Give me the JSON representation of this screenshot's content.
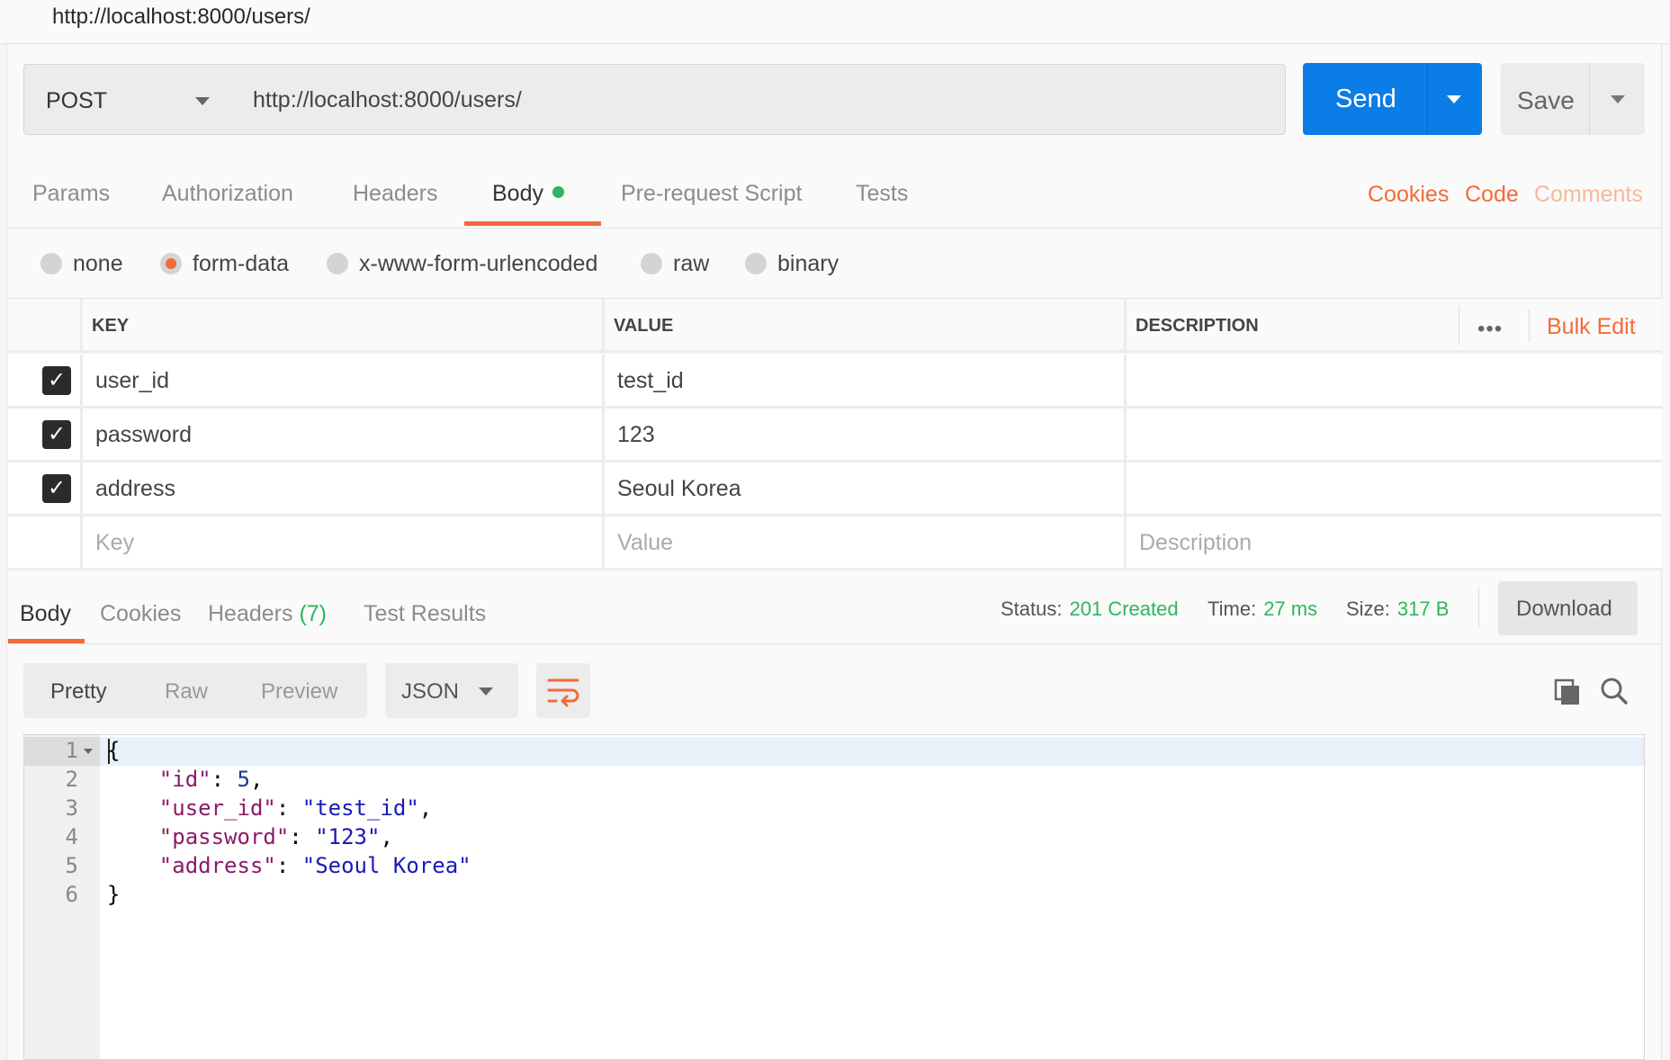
{
  "window": {
    "title": "http://localhost:8000/users/"
  },
  "request": {
    "method": "POST",
    "url": "http://localhost:8000/users/",
    "send_label": "Send",
    "save_label": "Save"
  },
  "request_tabs": {
    "items": [
      {
        "label": "Params"
      },
      {
        "label": "Authorization"
      },
      {
        "label": "Headers"
      },
      {
        "label": "Body",
        "active": true
      },
      {
        "label": "Pre-request Script"
      },
      {
        "label": "Tests"
      }
    ],
    "right_links": [
      "Cookies",
      "Code",
      "Comments"
    ]
  },
  "body_types": {
    "options": [
      "none",
      "form-data",
      "x-www-form-urlencoded",
      "raw",
      "binary"
    ],
    "selected": "form-data"
  },
  "form_table": {
    "headers": {
      "key": "KEY",
      "value": "VALUE",
      "description": "DESCRIPTION"
    },
    "more": "•••",
    "bulk_edit": "Bulk Edit",
    "rows": [
      {
        "checked": true,
        "key": "user_id",
        "value": "test_id",
        "description": ""
      },
      {
        "checked": true,
        "key": "password",
        "value": "123",
        "description": ""
      },
      {
        "checked": true,
        "key": "address",
        "value": "Seoul Korea",
        "description": ""
      }
    ],
    "placeholders": {
      "key": "Key",
      "value": "Value",
      "description": "Description"
    }
  },
  "response": {
    "tabs": {
      "body": "Body",
      "cookies": "Cookies",
      "headers": "Headers",
      "headers_count": "(7)",
      "test_results": "Test Results"
    },
    "status_label": "Status:",
    "status_value": "201 Created",
    "time_label": "Time:",
    "time_value": "27 ms",
    "size_label": "Size:",
    "size_value": "317 B",
    "download_label": "Download",
    "view_modes": [
      "Pretty",
      "Raw",
      "Preview"
    ],
    "format": "JSON",
    "line_numbers": [
      "1",
      "2",
      "3",
      "4",
      "5",
      "6"
    ],
    "json": {
      "open": "{",
      "close": "}",
      "fields": [
        {
          "key": "\"id\"",
          "value": "5",
          "type": "number",
          "comma": true
        },
        {
          "key": "\"user_id\"",
          "value": "\"test_id\"",
          "type": "string",
          "comma": true
        },
        {
          "key": "\"password\"",
          "value": "\"123\"",
          "type": "string",
          "comma": true
        },
        {
          "key": "\"address\"",
          "value": "\"Seoul Korea\"",
          "type": "string",
          "comma": false
        }
      ]
    }
  },
  "colors": {
    "accent": "#f26b3a",
    "primary": "#0b7de7",
    "success": "#2eb55f"
  },
  "icons": [
    "caret-down-icon",
    "checkbox-checked-icon",
    "wrap-lines-icon",
    "copy-icon",
    "search-icon",
    "status-dot-icon"
  ]
}
